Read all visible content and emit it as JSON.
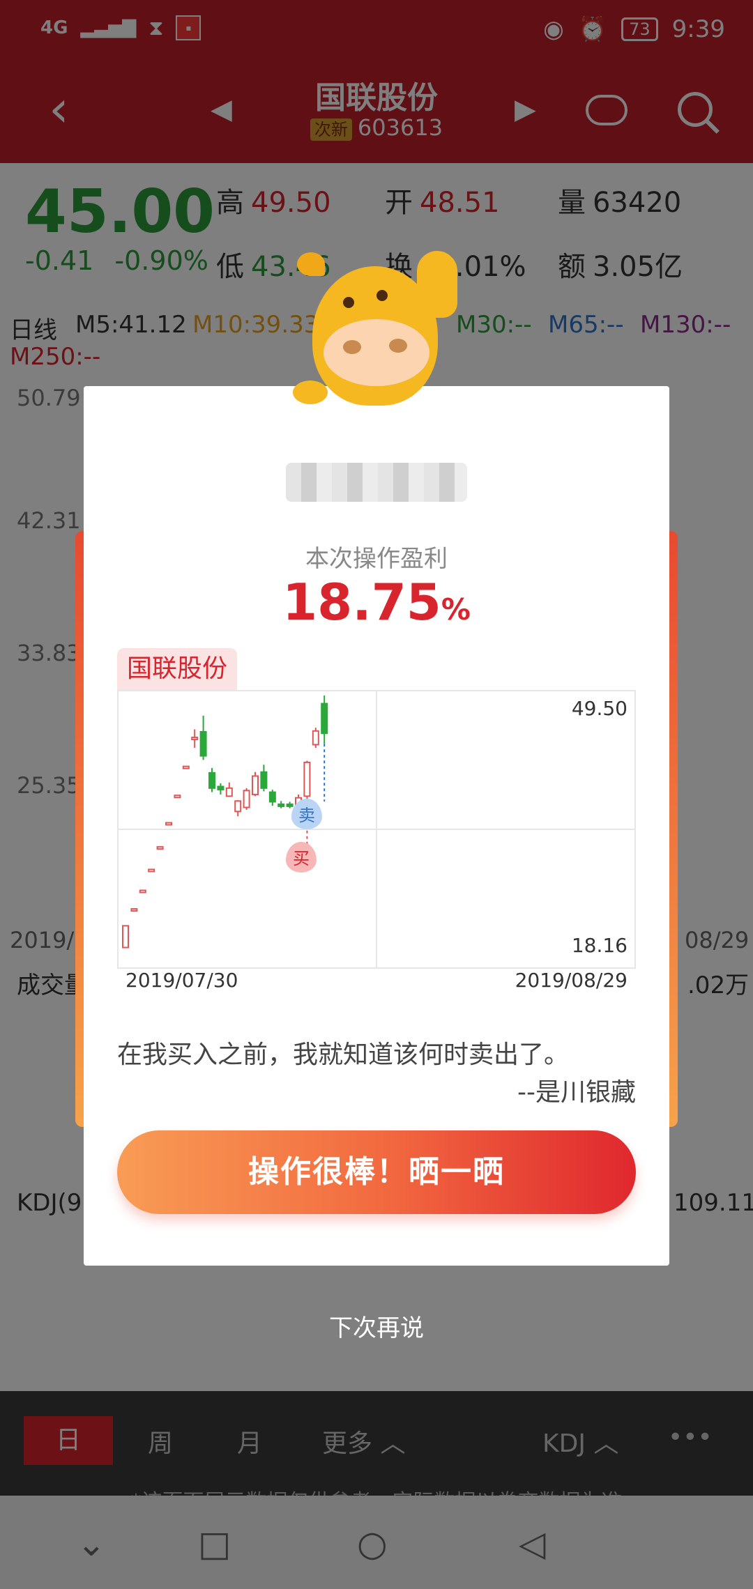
{
  "status": {
    "network": "4G",
    "time": "9:39",
    "battery": "73"
  },
  "nav": {
    "stock_name": "国联股份",
    "tag": "次新",
    "code": "603613"
  },
  "quote": {
    "price": "45.00",
    "change": "-0.41",
    "change_pct": "-0.90%",
    "high_label": "高",
    "high": "49.50",
    "open_label": "开",
    "open": "48.51",
    "volume_label": "量",
    "volume": "63420",
    "low_label": "低",
    "low": "43.46",
    "turnover_label": "换",
    "turnover": "18.01%",
    "amount_label": "额",
    "amount": "3.05亿"
  },
  "ma": {
    "period": "日线",
    "m5": "M5:41.12",
    "m10": "M10:39.33",
    "m30": "M30:--",
    "m65": "M65:--",
    "m130": "M130:--",
    "m250": "M250:--"
  },
  "kchart": {
    "y_labels": [
      "50.79",
      "42.31",
      "33.83",
      "25.35"
    ],
    "date_left": "2019/0",
    "date_right": "08/29",
    "volume_label": "成交量",
    "volume_value": ".02万",
    "kdj_label": "KDJ(9",
    "kdj_value": "109.11"
  },
  "bottom_tabs": {
    "day": "日",
    "week": "周",
    "month": "月",
    "more": "更多 ︿",
    "indicator": "KDJ ︿",
    "menu": "•••"
  },
  "disclaimer": "*该页面展示数据仅供参考，实际数据以券商数据为准",
  "dialog": {
    "profit_label": "本次操作盈利",
    "profit_value": "18.75",
    "profit_unit": "%",
    "stock_tag": "国联股份",
    "quote_text": "在我买入之前，我就知道该何时卖出了。",
    "quote_author": "--是川银藏",
    "share_button": "操作很棒！晒一晒",
    "later": "下次再说"
  },
  "chart_data": {
    "type": "candlestick",
    "ylim": [
      18.16,
      49.5
    ],
    "y_high_label": "49.50",
    "y_low_label": "18.16",
    "x_start": "2019/07/30",
    "x_end": "2019/08/29",
    "buy_marker": "买",
    "sell_marker": "卖",
    "candles": [
      {
        "o": 18.2,
        "c": 20.9,
        "h": 20.9,
        "l": 18.2
      },
      {
        "o": 22.9,
        "c": 23.0,
        "h": 23.0,
        "l": 22.9
      },
      {
        "o": 25.2,
        "c": 25.3,
        "h": 25.3,
        "l": 25.2
      },
      {
        "o": 27.8,
        "c": 27.9,
        "h": 27.9,
        "l": 27.8
      },
      {
        "o": 30.6,
        "c": 30.7,
        "h": 30.7,
        "l": 30.6
      },
      {
        "o": 33.6,
        "c": 33.7,
        "h": 33.7,
        "l": 33.6
      },
      {
        "o": 37.0,
        "c": 37.1,
        "h": 37.1,
        "l": 37.0
      },
      {
        "o": 40.6,
        "c": 40.7,
        "h": 40.7,
        "l": 40.6
      },
      {
        "o": 44.1,
        "c": 44.3,
        "h": 45.3,
        "l": 43.0
      },
      {
        "o": 45.0,
        "c": 42.0,
        "h": 47.0,
        "l": 41.5
      },
      {
        "o": 39.9,
        "c": 38.0,
        "h": 40.5,
        "l": 37.5
      },
      {
        "o": 38.2,
        "c": 37.8,
        "h": 38.6,
        "l": 37.2
      },
      {
        "o": 37.0,
        "c": 38.0,
        "h": 38.7,
        "l": 36.9
      },
      {
        "o": 35.1,
        "c": 36.4,
        "h": 36.5,
        "l": 34.5
      },
      {
        "o": 35.6,
        "c": 37.7,
        "h": 38.0,
        "l": 35.3
      },
      {
        "o": 37.2,
        "c": 39.5,
        "h": 40.0,
        "l": 37.0
      },
      {
        "o": 40.0,
        "c": 38.0,
        "h": 40.9,
        "l": 37.6
      },
      {
        "o": 37.5,
        "c": 36.3,
        "h": 37.8,
        "l": 35.8
      },
      {
        "o": 36.0,
        "c": 35.8,
        "h": 36.4,
        "l": 35.5
      },
      {
        "o": 36.0,
        "c": 35.8,
        "h": 36.3,
        "l": 35.5
      },
      {
        "o": 35.6,
        "c": 36.8,
        "h": 37.2,
        "l": 35.3
      },
      {
        "o": 37.0,
        "c": 41.2,
        "h": 41.4,
        "l": 36.5
      },
      {
        "o": 43.4,
        "c": 45.1,
        "h": 45.5,
        "l": 43.0
      },
      {
        "o": 48.5,
        "c": 44.8,
        "h": 49.5,
        "l": 43.5
      }
    ]
  }
}
